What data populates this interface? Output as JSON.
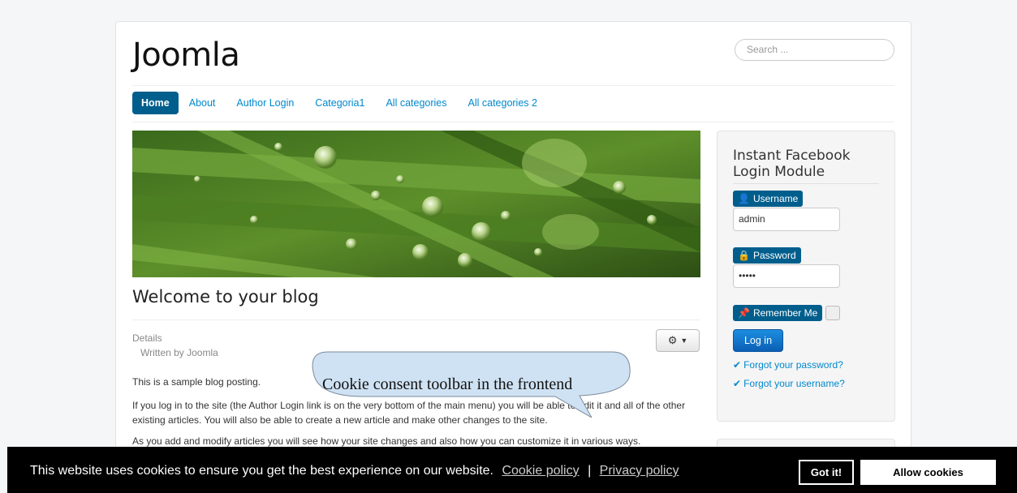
{
  "brand": "Joomla",
  "search": {
    "placeholder": "Search ..."
  },
  "nav": [
    "Home",
    "About",
    "Author Login",
    "Categoria1",
    "All categories",
    "All categories 2"
  ],
  "article": {
    "title": "Welcome to your blog",
    "details_label": "Details",
    "written_by": "Written by Joomla",
    "p1": "This is a sample blog posting.",
    "p2": "If you log in to the site (the Author Login link is on the very bottom of the main menu) you will be able to edit it and all of the other existing articles. You will also be able to create a new article and make other changes to the site.",
    "p3": "As you add and modify articles you will see how your site changes and also how you can customize it in various ways."
  },
  "login_module": {
    "title": "Instant Facebook Login Module",
    "username_label": "Username",
    "username_value": "admin",
    "password_label": "Password",
    "password_value": "•••••",
    "remember_label": "Remember Me",
    "login_button": "Log in",
    "forgot_password": "Forgot your password?",
    "forgot_username": "Forgot your username?"
  },
  "callout": {
    "text": "Cookie consent toolbar in the frontend"
  },
  "cookie_bar": {
    "message": "This website uses cookies to ensure you get the best experience on our website.",
    "cookie_policy": "Cookie policy",
    "separator": "|",
    "privacy_policy": "Privacy policy",
    "got_it": "Got it!",
    "allow": "Allow cookies"
  },
  "colors": {
    "accent": "#005e8d",
    "link": "#0088cc",
    "cookie_bar_bg": "#000000"
  }
}
